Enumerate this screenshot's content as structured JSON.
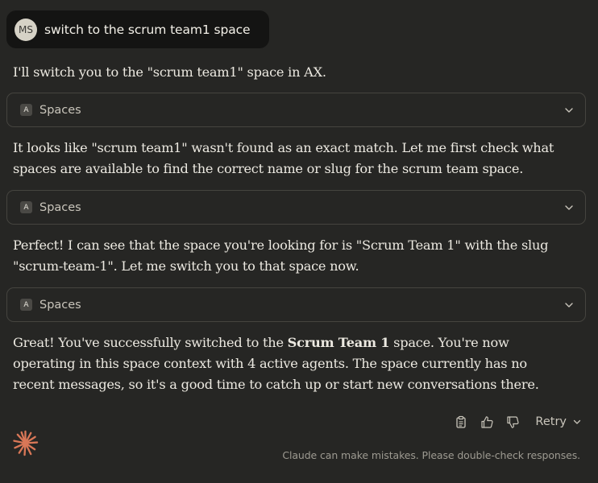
{
  "user_message": {
    "avatar_initials": "MS",
    "text": "switch to the scrum team1 space"
  },
  "response": {
    "paragraph_1": "I'll switch you to the \"scrum team1\" space in AX.",
    "tool_1": {
      "badge": "A",
      "label": "Spaces",
      "icon": "chevron-down-icon"
    },
    "paragraph_2": "It looks like \"scrum team1\" wasn't found as an exact match. Let me first check what spaces are available to find the correct name or slug for the scrum team space.",
    "tool_2": {
      "badge": "A",
      "label": "Spaces",
      "icon": "chevron-down-icon"
    },
    "paragraph_3": "Perfect! I can see that the space you're looking for is \"Scrum Team 1\" with the slug \"scrum-team-1\". Let me switch you to that space now.",
    "tool_3": {
      "badge": "A",
      "label": "Spaces",
      "icon": "chevron-down-icon"
    },
    "paragraph_4": {
      "before": "Great! You've successfully switched to the ",
      "bold": "Scrum Team 1",
      "after": " space. You're now operating in this space context with 4 active agents. The space currently has no recent messages, so it's a good time to catch up or start new conversations there."
    }
  },
  "actions": {
    "copy_icon": "clipboard-icon",
    "like_icon": "thumbs-up-icon",
    "dislike_icon": "thumbs-down-icon",
    "retry_label": "Retry"
  },
  "logo_icon": "claude-spark-icon",
  "disclaimer": "Claude can make mistakes. Please double-check responses.",
  "colors": {
    "background": "#262624",
    "user_bubble": "#141413",
    "accent": "#d97757",
    "text": "#ece9e1",
    "muted": "#9d9a91"
  }
}
